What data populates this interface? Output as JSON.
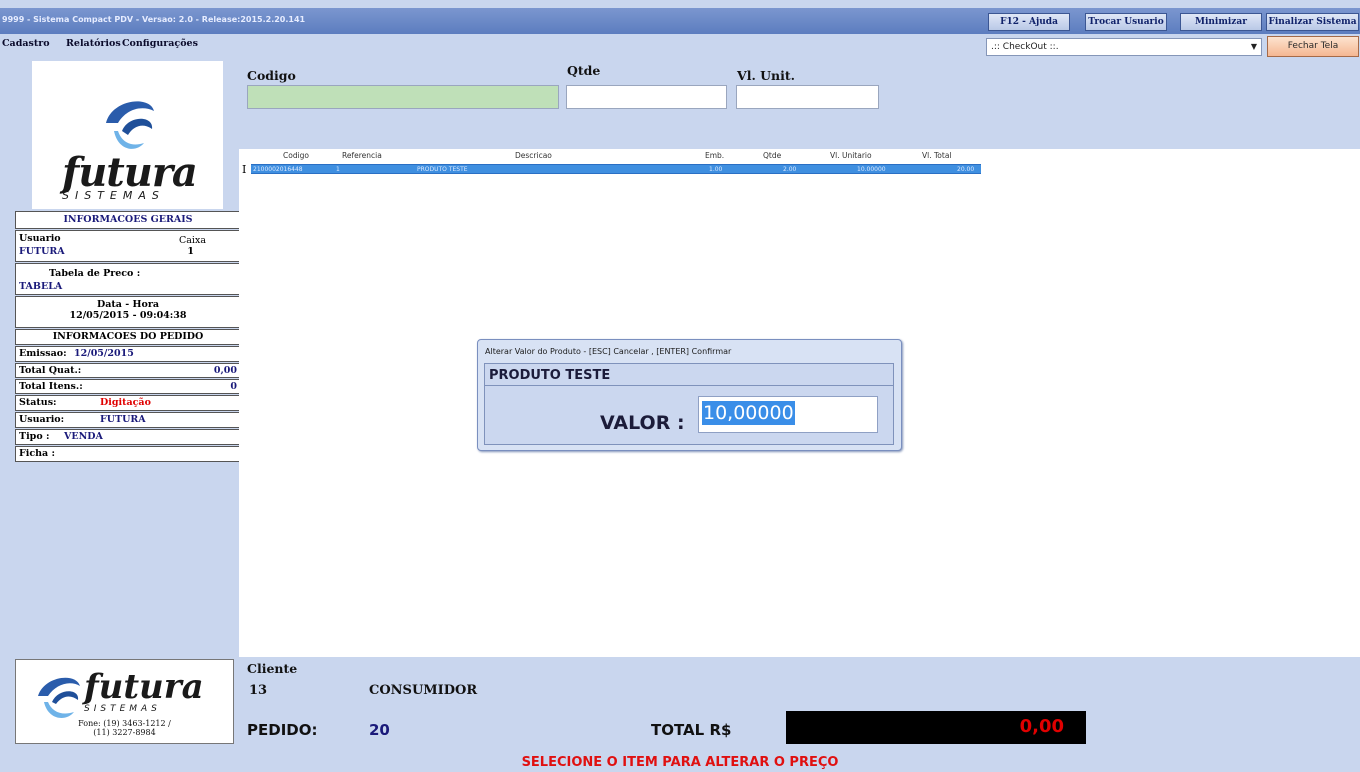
{
  "titlebar": {
    "title": "9999 - Sistema Compact PDV - Versao: 2.0 - Release:2015.2.20.141",
    "buttons": [
      "F12 - Ajuda",
      "Trocar Usuario",
      "Minimizar",
      "Finalizar Sistema"
    ]
  },
  "menu": [
    "Cadastro",
    "Relatórios",
    "Configurações"
  ],
  "checkout": {
    "value": ".:: CheckOut ::."
  },
  "fechar_label": "Fechar Tela",
  "logo": {
    "word": "futura",
    "sub": "SISTEMAS"
  },
  "info": {
    "header": "INFORMACOES GERAIS",
    "usuario_label": "Usuario",
    "usuario_value": "FUTURA",
    "caixa_label": "Caixa",
    "caixa_value": "1",
    "tabela_label": "Tabela de Preco :",
    "tabela_value": "TABELA",
    "datahora_label": "Data - Hora",
    "datahora_value": "12/05/2015 - 09:04:38",
    "pedido_header": "INFORMACOES DO PEDIDO",
    "emissao_label": "Emissao:",
    "emissao_value": "12/05/2015",
    "total_quat_label": "Total Quat.:",
    "total_quat_value": "0,00",
    "total_itens_label": "Total Itens.:",
    "total_itens_value": "0",
    "status_label": "Status:",
    "status_value": "Digitação",
    "usuario2_label": "Usuario:",
    "usuario2_value": "FUTURA",
    "tipo_label": "Tipo :",
    "tipo_value": "VENDA",
    "ficha_label": "Ficha :"
  },
  "form": {
    "codigo_label": "Codigo",
    "qtde_label": "Qtde",
    "vlunit_label": "Vl. Unit."
  },
  "grid": {
    "columns": [
      "Codigo",
      "Referencia",
      "Descricao",
      "Emb.",
      "Qtde",
      "Vl. Unitario",
      "Vl. Total"
    ],
    "rows": [
      {
        "codigo": "2100002016448",
        "referencia": "1",
        "descricao": "PRODUTO TESTE",
        "emb": "1.00",
        "qtde": "2.00",
        "vl_unitario": "10.00000",
        "vl_total": "20.00"
      }
    ]
  },
  "dialog": {
    "title": "Alterar Valor do Produto - [ESC] Cancelar , [ENTER] Confirmar",
    "product": "PRODUTO TESTE",
    "valor_label": "VALOR :",
    "valor_value": "10,00000"
  },
  "bottom": {
    "cliente_label": "Cliente",
    "cliente_code": "13",
    "cliente_name": "CONSUMIDOR",
    "pedido_label": "PEDIDO:",
    "pedido_value": "20",
    "total_label": "TOTAL R$",
    "total_value": "0,00",
    "fone": "Fone: (19) 3463-1212 /",
    "fone2": "(11) 3227-8984"
  },
  "status_message": "SELECIONE O ITEM PARA ALTERAR O PREÇO",
  "colors": {
    "accent": "#3a8ee8",
    "status_red": "#e00000",
    "panel": "#c9d6ee"
  }
}
